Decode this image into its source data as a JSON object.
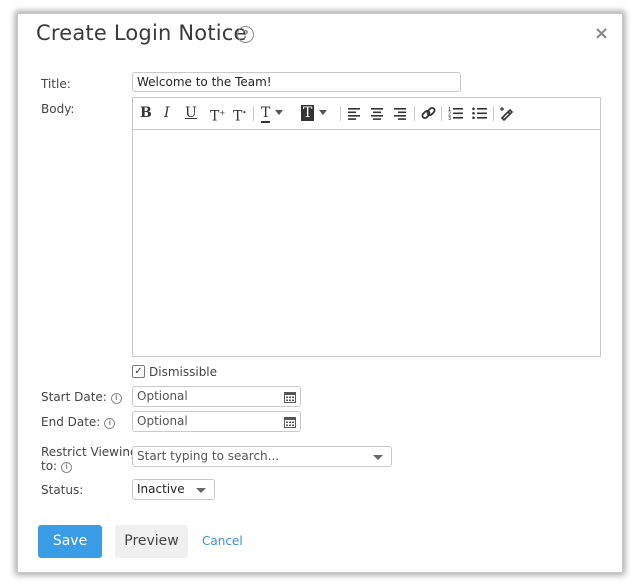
{
  "dialog": {
    "title": "Create Login Notice",
    "help_icon": "question-circle-icon",
    "close_icon": "close-icon"
  },
  "form": {
    "title_label": "Title:",
    "title_value": "Welcome to the Team!",
    "body_label": "Body:",
    "dismissible_label": "Dismissible",
    "dismissible_checked": true,
    "start_date_label": "Start Date:",
    "start_date_placeholder": "Optional",
    "end_date_label": "End Date:",
    "end_date_placeholder": "Optional",
    "restrict_label_line1": "Restrict Viewing",
    "restrict_label_line2": "to:",
    "restrict_placeholder": "Start typing to search...",
    "status_label": "Status:",
    "status_value": "Inactive"
  },
  "toolbar": {
    "bold": "B",
    "italic": "I",
    "underline": "U",
    "superscript": "T",
    "subscript": "T",
    "text_color": "T",
    "bg_color": "T"
  },
  "actions": {
    "save": "Save",
    "preview": "Preview",
    "cancel": "Cancel"
  },
  "colors": {
    "primary": "#3a9ce4",
    "link": "#3a8fd6"
  }
}
